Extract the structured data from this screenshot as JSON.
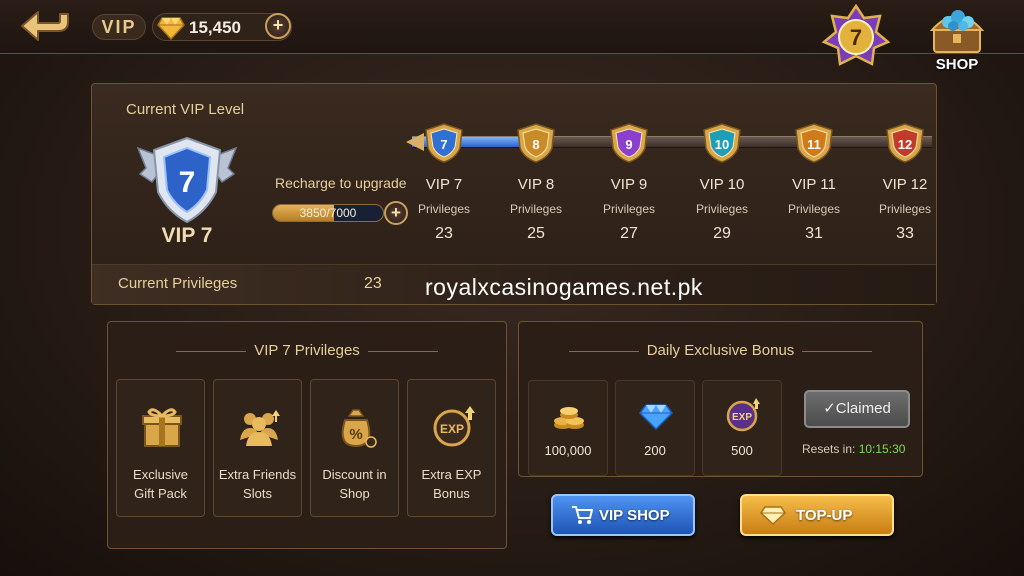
{
  "header": {
    "vip_label": "VIP",
    "gems": "15,450",
    "plus": "+",
    "current_level_badge": "7",
    "shop_label": "SHOP"
  },
  "vip_panel": {
    "title": "Current VIP Level",
    "level_number": "7",
    "level_label": "VIP 7",
    "recharge_label": "Recharge to upgrade",
    "progress_text": "3850/7000",
    "progress_fraction": 0.55,
    "track_fill_fraction": 0.22,
    "levels": [
      {
        "badge": "7",
        "name": "VIP 7",
        "sub": "Privileges",
        "count": "23",
        "color": "#2f6fd6"
      },
      {
        "badge": "8",
        "name": "VIP 8",
        "sub": "Privileges",
        "count": "25",
        "color": "#c98a2a"
      },
      {
        "badge": "9",
        "name": "VIP 9",
        "sub": "Privileges",
        "count": "27",
        "color": "#8a3fcf"
      },
      {
        "badge": "10",
        "name": "VIP 10",
        "sub": "Privileges",
        "count": "29",
        "color": "#1f9fb7"
      },
      {
        "badge": "11",
        "name": "VIP 11",
        "sub": "Privileges",
        "count": "31",
        "color": "#d07a1a"
      },
      {
        "badge": "12",
        "name": "VIP 12",
        "sub": "Privileges",
        "count": "33",
        "color": "#c23a2a"
      }
    ],
    "current_privileges_label": "Current Privileges",
    "current_privileges_value": "23"
  },
  "watermark": "royalxcasinogames.net.pk",
  "privileges": {
    "title": "VIP 7 Privileges",
    "items": [
      {
        "line1": "Exclusive",
        "line2": "Gift Pack",
        "icon": "gift-icon"
      },
      {
        "line1": "Extra Friends",
        "line2": "Slots",
        "icon": "friends-icon"
      },
      {
        "line1": "Discount in",
        "line2": "Shop",
        "icon": "discount-bag-icon"
      },
      {
        "line1": "Extra EXP",
        "line2": "Bonus",
        "icon": "exp-icon"
      }
    ]
  },
  "daily_bonus": {
    "title": "Daily Exclusive Bonus",
    "items": [
      {
        "amount": "100,000",
        "icon": "coins-icon"
      },
      {
        "amount": "200",
        "icon": "diamond-icon"
      },
      {
        "amount": "500",
        "icon": "exp-icon"
      }
    ],
    "claimed_label": "✓Claimed",
    "resets_label": "Resets in:",
    "resets_time": "10:15:30"
  },
  "buttons": {
    "vip_shop": "VIP SHOP",
    "top_up": "TOP-UP"
  }
}
